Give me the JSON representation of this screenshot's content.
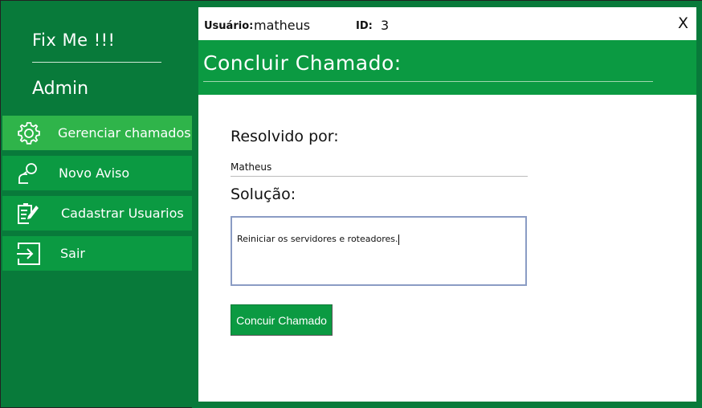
{
  "sidebar": {
    "app_title": "Fix Me !!!",
    "role": "Admin",
    "items": [
      {
        "label": "Gerenciar chamados",
        "icon": "gear-icon",
        "active": true
      },
      {
        "label": "Novo Aviso",
        "icon": "user-notice-icon",
        "active": false
      },
      {
        "label": "Cadastrar Usuarios",
        "icon": "clipboard-edit-icon",
        "active": false
      },
      {
        "label": "Sair",
        "icon": "exit-icon",
        "active": false
      }
    ]
  },
  "header": {
    "user_label": "Usuário:",
    "user_value": "matheus",
    "id_label": "ID:",
    "id_value": "3",
    "close_label": "X",
    "title": "Concluir  Chamado:"
  },
  "form": {
    "resolved_label": "Resolvido por:",
    "resolved_value": "Matheus",
    "solution_label": "Solução:",
    "solution_value": "Reiniciar os servidores e roteadores.",
    "submit_label": "Concuir Chamado"
  },
  "colors": {
    "sidebar_bg": "#087a3a",
    "nav_bg": "#0b9a42",
    "nav_active_bg": "#2fb44a",
    "header_bg": "#0b9a42"
  }
}
